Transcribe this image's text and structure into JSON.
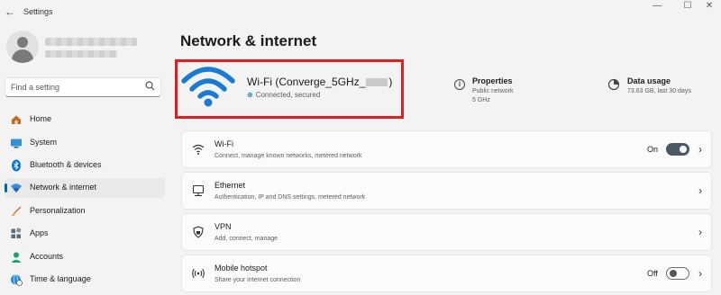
{
  "window": {
    "title": "Settings",
    "back_glyph": "←",
    "minimize_glyph": "—",
    "maximize_glyph": "☐",
    "close_glyph": "✕"
  },
  "search": {
    "placeholder": "Find a setting",
    "icon": "search-icon"
  },
  "sidebar": {
    "items": [
      {
        "label": "Home",
        "icon": "home-icon",
        "active": false
      },
      {
        "label": "System",
        "icon": "system-icon",
        "active": false
      },
      {
        "label": "Bluetooth & devices",
        "icon": "bluetooth-icon",
        "active": false
      },
      {
        "label": "Network & internet",
        "icon": "network-icon",
        "active": true
      },
      {
        "label": "Personalization",
        "icon": "brush-icon",
        "active": false
      },
      {
        "label": "Apps",
        "icon": "apps-icon",
        "active": false
      },
      {
        "label": "Accounts",
        "icon": "accounts-icon",
        "active": false
      },
      {
        "label": "Time & language",
        "icon": "globe-clock-icon",
        "active": false
      }
    ]
  },
  "main": {
    "title": "Network & internet",
    "connection": {
      "name": "Wi-Fi (Converge_5GHz_",
      "name_suffix": ")",
      "status": "Connected, secured",
      "properties": {
        "title": "Properties",
        "line1": "Public network",
        "line2": "5 GHz"
      },
      "data_usage": {
        "title": "Data usage",
        "detail": "73.63 GB, last 30 days"
      }
    },
    "cards": [
      {
        "title": "Wi-Fi",
        "subtitle": "Connect, manage known networks, metered network",
        "state": "On",
        "toggle": "on",
        "icon": "wifi-icon"
      },
      {
        "title": "Ethernet",
        "subtitle": "Authentication, IP and DNS settings, metered network",
        "icon": "ethernet-icon"
      },
      {
        "title": "VPN",
        "subtitle": "Add, connect, manage",
        "icon": "vpn-shield-icon"
      },
      {
        "title": "Mobile hotspot",
        "subtitle": "Share your internet connection",
        "state": "Off",
        "toggle": "off",
        "icon": "hotspot-icon"
      }
    ]
  },
  "colors": {
    "accent": "#0067c0",
    "highlight_border": "#e02020",
    "background": "#f3f3f3",
    "card": "#fbfbfb"
  }
}
